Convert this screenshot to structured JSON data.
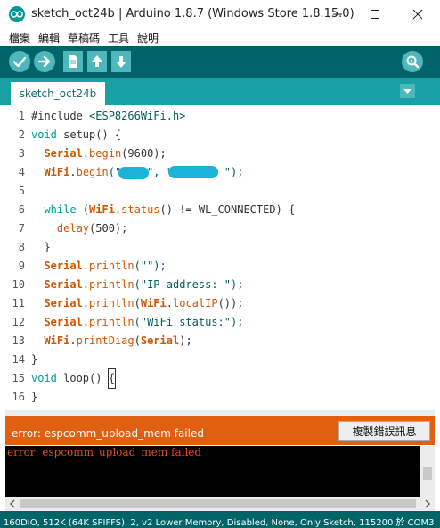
{
  "window": {
    "title": "sketch_oct24b | Arduino 1.8.7 (Windows Store 1.8.15.0)"
  },
  "menu": [
    "檔案",
    "編輯",
    "草稿碼",
    "工具",
    "說明"
  ],
  "toolbar": {
    "buttons": [
      "verify-icon",
      "upload-icon",
      "new-icon",
      "open-icon",
      "save-icon",
      "serial-monitor-icon"
    ],
    "accent": "#006468",
    "button_color": "#4db7bb"
  },
  "tabs": [
    {
      "label": "sketch_oct24b"
    }
  ],
  "editor": {
    "line_numbers": [
      "1",
      "2",
      "3",
      "4",
      "5",
      "6",
      "7",
      "8",
      "9",
      "10",
      "11",
      "12",
      "13",
      "14",
      "15",
      "16"
    ],
    "lines": {
      "l1_a": "#include ",
      "l1_b": "<ESP8266WiFi.h>",
      "l2_a": "void",
      "l2_b": " setup() {",
      "l3_a": "  ",
      "l3_b": "Serial",
      "l3_c": ".",
      "l3_d": "begin",
      "l3_e": "(9600);",
      "l4_a": "  ",
      "l4_b": "WiFi",
      "l4_c": ".",
      "l4_d": "begin",
      "l4_e": "(\"    \", \"        \");",
      "l6_a": "  ",
      "l6_b": "while",
      "l6_c": " (",
      "l6_d": "WiFi",
      "l6_e": ".",
      "l6_f": "status",
      "l6_g": "() != WL_CONNECTED) {",
      "l7_a": "    ",
      "l7_b": "delay",
      "l7_c": "(500);",
      "l8": "  }",
      "l9_a": "  ",
      "l9_b": "Serial",
      "l9_c": ".",
      "l9_d": "println",
      "l9_e": "(\"\");",
      "l10_a": "  ",
      "l10_b": "Serial",
      "l10_c": ".",
      "l10_d": "println",
      "l10_e": "(\"IP address: \");",
      "l11_a": "  ",
      "l11_b": "Serial",
      "l11_c": ".",
      "l11_d": "println",
      "l11_e": "(",
      "l11_f": "WiFi",
      "l11_g": ".",
      "l11_h": "localIP",
      "l11_i": "());",
      "l12_a": "  ",
      "l12_b": "Serial",
      "l12_c": ".",
      "l12_d": "println",
      "l12_e": "(\"WiFi status:\");",
      "l13_a": "  ",
      "l13_b": "WiFi",
      "l13_c": ".",
      "l13_d": "printDiag",
      "l13_e": "(",
      "l13_f": "Serial",
      "l13_g": ");",
      "l14": "}",
      "l15_a": "void",
      "l15_b": " loop() ",
      "l15_c": "{",
      "l16": "}"
    }
  },
  "error_bar": {
    "message": "error: espcomm_upload_mem failed",
    "copy_button": "複製錯誤訊息",
    "color": "#e05f11"
  },
  "console": {
    "text": "error: espcomm_upload_mem failed"
  },
  "status_bar": {
    "text": "160DIO, 512K (64K SPIFFS), 2, v2 Lower Memory, Disabled, None, Only Sketch, 115200 於 COM3"
  }
}
